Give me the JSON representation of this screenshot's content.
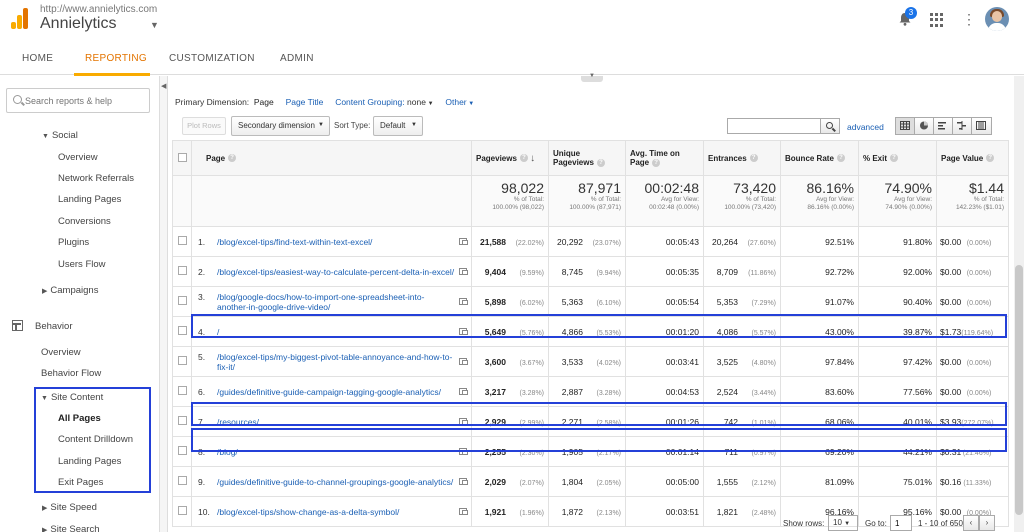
{
  "header": {
    "site_url": "http://www.annielytics.com",
    "site_name": "Annielytics",
    "notification_count": "3"
  },
  "nav": {
    "tabs": [
      "HOME",
      "REPORTING",
      "CUSTOMIZATION",
      "ADMIN"
    ],
    "active": "REPORTING"
  },
  "sidebar": {
    "search_placeholder": "Search reports & help",
    "social": "Social",
    "social_items": [
      "Overview",
      "Network Referrals",
      "Landing Pages",
      "Conversions",
      "Plugins",
      "Users Flow"
    ],
    "campaigns": "Campaigns",
    "behavior": "Behavior",
    "behavior_items": [
      "Overview",
      "Behavior Flow"
    ],
    "site_content": "Site Content",
    "site_content_items": [
      "All Pages",
      "Content Drilldown",
      "Landing Pages",
      "Exit Pages"
    ],
    "site_speed": "Site Speed",
    "site_search": "Site Search"
  },
  "toolbar": {
    "primary_dimension_label": "Primary Dimension:",
    "dim_page": "Page",
    "dim_page_title": "Page Title",
    "dim_content_grouping": "Content Grouping:",
    "dim_content_grouping_value": "none",
    "dim_other": "Other",
    "plot_rows": "Plot Rows",
    "secondary_dimension": "Secondary dimension",
    "sort_type_label": "Sort Type:",
    "sort_type_value": "Default",
    "advanced": "advanced"
  },
  "table": {
    "headers": {
      "page": "Page",
      "pageviews": "Pageviews",
      "unique_pageviews": "Unique Pageviews",
      "avg_time": "Avg. Time on Page",
      "entrances": "Entrances",
      "bounce_rate": "Bounce Rate",
      "exit": "% Exit",
      "page_value": "Page Value"
    },
    "totals": {
      "pageviews": "98,022",
      "pageviews_sub1": "% of Total:",
      "pageviews_sub2": "100.00% (98,022)",
      "unique": "87,971",
      "unique_sub1": "% of Total:",
      "unique_sub2": "100.00% (87,971)",
      "avg_time": "00:02:48",
      "avg_time_sub1": "Avg for View:",
      "avg_time_sub2": "00:02:48 (0.00%)",
      "entrances": "73,420",
      "entrances_sub1": "% of Total:",
      "entrances_sub2": "100.00% (73,420)",
      "bounce": "86.16%",
      "bounce_sub1": "Avg for View:",
      "bounce_sub2": "86.16% (0.00%)",
      "exit": "74.90%",
      "exit_sub1": "Avg for View:",
      "exit_sub2": "74.90% (0.00%)",
      "value": "$1.44",
      "value_sub1": "% of Total:",
      "value_sub2": "142.23% ($1.01)"
    },
    "rows": [
      {
        "idx": "1.",
        "page": "/blog/excel-tips/find-text-within-text-excel/",
        "pv": "21,588",
        "pv_pct": "(22.02%)",
        "upv": "20,292",
        "upv_pct": "(23.07%)",
        "time": "00:05:43",
        "ent": "20,264",
        "ent_pct": "(27.60%)",
        "bounce": "92.51%",
        "exit": "91.80%",
        "val": "$0.00",
        "val_pct": "(0.00%)"
      },
      {
        "idx": "2.",
        "page": "/blog/excel-tips/easiest-way-to-calculate-percent-delta-in-excel/",
        "pv": "9,404",
        "pv_pct": "(9.59%)",
        "upv": "8,745",
        "upv_pct": "(9.94%)",
        "time": "00:05:35",
        "ent": "8,709",
        "ent_pct": "(11.86%)",
        "bounce": "92.72%",
        "exit": "92.00%",
        "val": "$0.00",
        "val_pct": "(0.00%)"
      },
      {
        "idx": "3.",
        "page": "/blog/google-docs/how-to-import-one-spreadsheet-into-another-in-google-drive-video/",
        "pv": "5,898",
        "pv_pct": "(6.02%)",
        "upv": "5,363",
        "upv_pct": "(6.10%)",
        "time": "00:05:54",
        "ent": "5,353",
        "ent_pct": "(7.29%)",
        "bounce": "91.07%",
        "exit": "90.40%",
        "val": "$0.00",
        "val_pct": "(0.00%)"
      },
      {
        "idx": "4.",
        "page": "/",
        "pv": "5,649",
        "pv_pct": "(5.76%)",
        "upv": "4,866",
        "upv_pct": "(5.53%)",
        "time": "00:01:20",
        "ent": "4,086",
        "ent_pct": "(5.57%)",
        "bounce": "43.00%",
        "exit": "39.87%",
        "val": "$1.73",
        "val_pct": "(119.64%)"
      },
      {
        "idx": "5.",
        "page": "/blog/excel-tips/my-biggest-pivot-table-annoyance-and-how-to-fix-it/",
        "pv": "3,600",
        "pv_pct": "(3.67%)",
        "upv": "3,533",
        "upv_pct": "(4.02%)",
        "time": "00:03:41",
        "ent": "3,525",
        "ent_pct": "(4.80%)",
        "bounce": "97.84%",
        "exit": "97.42%",
        "val": "$0.00",
        "val_pct": "(0.00%)"
      },
      {
        "idx": "6.",
        "page": "/guides/definitive-guide-campaign-tagging-google-analytics/",
        "pv": "3,217",
        "pv_pct": "(3.28%)",
        "upv": "2,887",
        "upv_pct": "(3.28%)",
        "time": "00:04:53",
        "ent": "2,524",
        "ent_pct": "(3.44%)",
        "bounce": "83.60%",
        "exit": "77.56%",
        "val": "$0.00",
        "val_pct": "(0.00%)"
      },
      {
        "idx": "7.",
        "page": "/resources/",
        "pv": "2,929",
        "pv_pct": "(2.99%)",
        "upv": "2,271",
        "upv_pct": "(2.58%)",
        "time": "00:01:26",
        "ent": "742",
        "ent_pct": "(1.01%)",
        "bounce": "68.06%",
        "exit": "40.01%",
        "val": "$3.93",
        "val_pct": "(272.07%)"
      },
      {
        "idx": "8.",
        "page": "/blog/",
        "pv": "2,255",
        "pv_pct": "(2.30%)",
        "upv": "1,905",
        "upv_pct": "(2.17%)",
        "time": "00:01:14",
        "ent": "711",
        "ent_pct": "(0.97%)",
        "bounce": "69.20%",
        "exit": "44.21%",
        "val": "$0.31",
        "val_pct": "(21.46%)"
      },
      {
        "idx": "9.",
        "page": "/guides/definitive-guide-to-channel-groupings-google-analytics/",
        "pv": "2,029",
        "pv_pct": "(2.07%)",
        "upv": "1,804",
        "upv_pct": "(2.05%)",
        "time": "00:05:00",
        "ent": "1,555",
        "ent_pct": "(2.12%)",
        "bounce": "81.09%",
        "exit": "75.01%",
        "val": "$0.16",
        "val_pct": "(11.33%)"
      },
      {
        "idx": "10.",
        "page": "/blog/excel-tips/show-change-as-a-delta-symbol/",
        "pv": "1,921",
        "pv_pct": "(1.96%)",
        "upv": "1,872",
        "upv_pct": "(2.13%)",
        "time": "00:03:51",
        "ent": "1,821",
        "ent_pct": "(2.48%)",
        "bounce": "96.16%",
        "exit": "95.16%",
        "val": "$0.00",
        "val_pct": "(0.00%)"
      }
    ]
  },
  "footer": {
    "show_rows_label": "Show rows:",
    "show_rows_value": "10",
    "goto_label": "Go to:",
    "goto_value": "1",
    "range": "1 - 10 of 650"
  }
}
